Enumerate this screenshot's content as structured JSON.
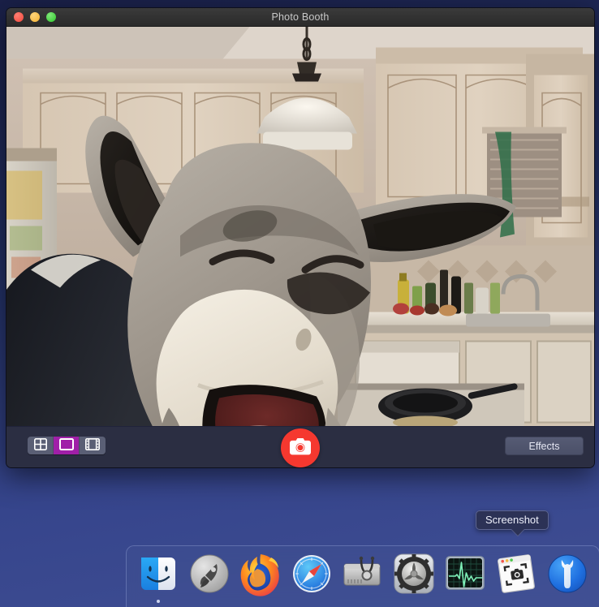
{
  "window": {
    "title": "Photo Booth",
    "traffic_lights": [
      {
        "name": "close",
        "color": "#f3483c"
      },
      {
        "name": "minimize",
        "color": "#f5b333"
      },
      {
        "name": "zoom",
        "color": "#2ec92b"
      }
    ]
  },
  "preview": {
    "description": "Live webcam preview showing a person wearing a grey and cream donkey fursuit head in a kitchen with light wood cabinets, a hanging pendant lamp, a sink, a countertop with bottles and produce, and a cast-iron skillet on the stove.",
    "alt": "webcam-live-preview"
  },
  "toolbar": {
    "modes": [
      {
        "name": "four-up-grid",
        "icon": "grid-4up-icon",
        "label": "4-up",
        "selected": false
      },
      {
        "name": "single-photo",
        "icon": "single-photo-icon",
        "label": "Photo",
        "selected": true
      },
      {
        "name": "movie-clip",
        "icon": "film-strip-icon",
        "label": "Movie",
        "selected": false
      }
    ],
    "shutter": {
      "icon": "camera-icon",
      "label": "Take Photo",
      "color": "#f5382f"
    },
    "effects_label": "Effects"
  },
  "tooltip": {
    "text": "Screenshot"
  },
  "dock": {
    "items": [
      {
        "name": "finder",
        "label": "Finder",
        "icon": "finder-icon",
        "running": true
      },
      {
        "name": "launchpad",
        "label": "Launchpad",
        "icon": "rocket-icon",
        "running": false
      },
      {
        "name": "firefox",
        "label": "Firefox",
        "icon": "firefox-icon",
        "running": false
      },
      {
        "name": "safari",
        "label": "Safari",
        "icon": "compass-icon",
        "running": false
      },
      {
        "name": "disk-utility",
        "label": "Disk Utility",
        "icon": "disk-stethoscope-icon",
        "running": false
      },
      {
        "name": "system-preferences",
        "label": "System Preferences",
        "icon": "gear-icon",
        "running": false
      },
      {
        "name": "activity-monitor",
        "label": "Activity Monitor",
        "icon": "ekg-monitor-icon",
        "running": false
      },
      {
        "name": "screenshot",
        "label": "Screenshot",
        "icon": "screenshot-window-icon",
        "running": false
      },
      {
        "name": "utility-wrench",
        "label": "Utility",
        "icon": "wrench-icon",
        "running": false
      }
    ]
  },
  "colors": {
    "desktop_top": "#1a2048",
    "desktop_bottom": "#3f4e93",
    "titlebar": "#323232",
    "toolbar": "#2b2e42",
    "accent_magenta": "#a01fa8",
    "shutter_red": "#f5382f"
  }
}
